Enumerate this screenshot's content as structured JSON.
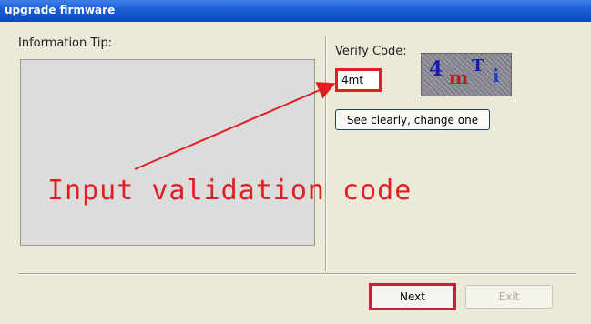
{
  "window": {
    "title": "upgrade firmware"
  },
  "info": {
    "label": "Information Tip:"
  },
  "verify": {
    "label": "Verify Code:",
    "input_value": "4mt",
    "captcha_chars": [
      "4",
      "m",
      "T",
      "i"
    ],
    "refresh_label": "See clearly, change one"
  },
  "annotation": {
    "text": "Input validation code",
    "color": "#e02020"
  },
  "footer": {
    "next_label": "Next",
    "exit_label": "Exit"
  }
}
